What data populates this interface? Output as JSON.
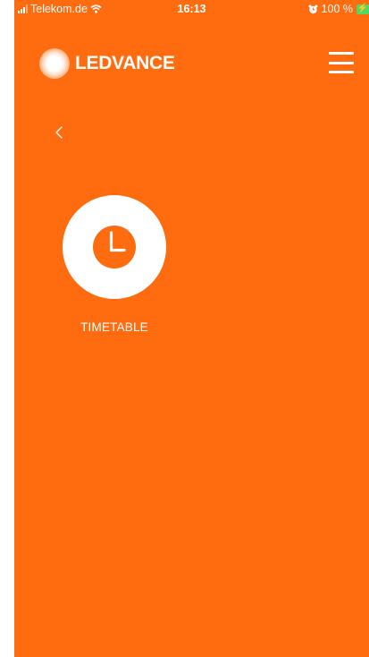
{
  "status_bar": {
    "carrier": "Telekom.de",
    "time": "16:13",
    "battery_percent": "100 %",
    "icons": [
      "signal-icon",
      "wifi-icon",
      "alarm-icon",
      "battery-charging-icon"
    ]
  },
  "header": {
    "logo_text": "LEDVANCE",
    "menu_icon": "hamburger-menu-icon"
  },
  "navigation": {
    "back_icon": "chevron-left-icon"
  },
  "tiles": [
    {
      "label": "TIMETABLE",
      "icon": "clock-icon"
    }
  ],
  "colors": {
    "background": "#ff6b0f",
    "foreground": "#ffffff",
    "battery": "#4cd964"
  }
}
